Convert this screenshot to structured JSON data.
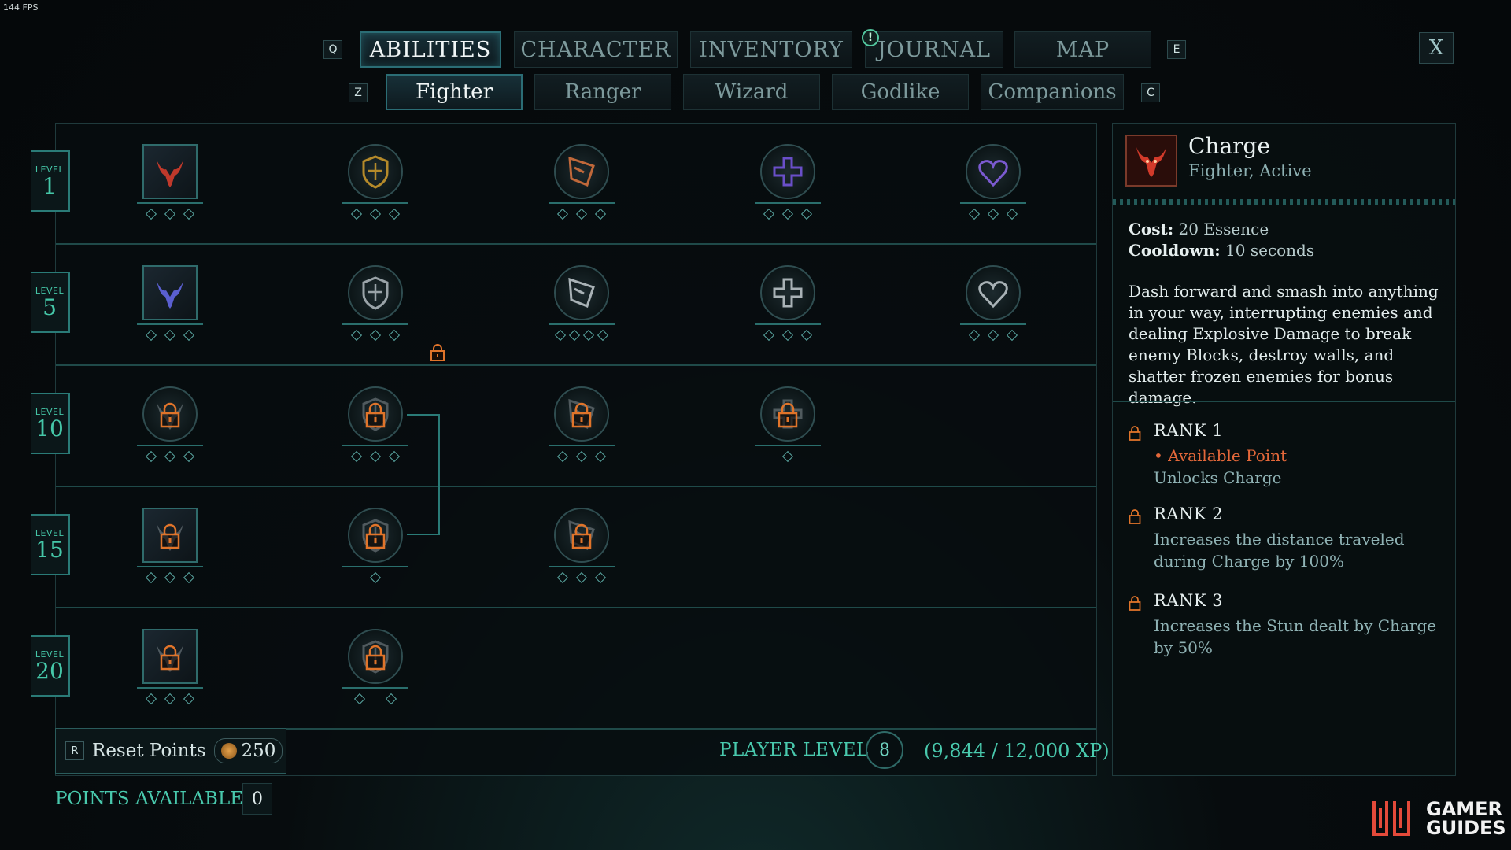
{
  "fps": "144 FPS",
  "nav": {
    "left_key": "Q",
    "right_key": "E",
    "tabs": [
      "ABILITIES",
      "CHARACTER",
      "INVENTORY",
      "JOURNAL",
      "MAP"
    ],
    "active_tab": "ABILITIES",
    "journal_alert": "!",
    "close": "X"
  },
  "subnav": {
    "left_key": "Z",
    "right_key": "C",
    "tabs": [
      "Fighter",
      "Ranger",
      "Wizard",
      "Godlike",
      "Companions"
    ],
    "active_tab": "Fighter"
  },
  "levels": [
    {
      "label": "LEVEL",
      "number": "1"
    },
    {
      "label": "LEVEL",
      "number": "5"
    },
    {
      "label": "LEVEL",
      "number": "10"
    },
    {
      "label": "LEVEL",
      "number": "15"
    },
    {
      "label": "LEVEL",
      "number": "20"
    }
  ],
  "abilities": [
    [
      {
        "icon": "bull-charge-icon",
        "shape": "square",
        "locked": false,
        "ranks": 3,
        "color": "#c0392b"
      },
      {
        "icon": "shield-burst-icon",
        "shape": "circle",
        "locked": false,
        "ranks": 3,
        "color": "#b58a2a"
      },
      {
        "icon": "shield-bash-icon",
        "shape": "circle",
        "locked": false,
        "ranks": 3,
        "color": "#c0683a"
      },
      {
        "icon": "holy-cross-icon",
        "shape": "circle",
        "locked": false,
        "ranks": 3,
        "color": "#6a4fc9"
      },
      {
        "icon": "heart-icon",
        "shape": "circle",
        "locked": false,
        "ranks": 3,
        "color": "#7b5ad0"
      }
    ],
    [
      {
        "icon": "dragon-claw-icon",
        "shape": "square",
        "locked": false,
        "ranks": 3,
        "color": "#5a5fd0"
      },
      {
        "icon": "axe-cleave-icon",
        "shape": "circle",
        "locked": false,
        "ranks": 3,
        "color": "#9aa3a8"
      },
      {
        "icon": "punch-icon",
        "shape": "circle",
        "locked": false,
        "ranks": 4,
        "color": "#a9b2b6"
      },
      {
        "icon": "skull-sword-icon",
        "shape": "circle",
        "locked": false,
        "ranks": 3,
        "color": "#a9b2b6"
      },
      {
        "icon": "battle-axe-icon",
        "shape": "circle",
        "locked": false,
        "ranks": 3,
        "color": "#a9b2b6"
      }
    ],
    [
      {
        "icon": "whirlwind-icon",
        "shape": "circle",
        "locked": true,
        "ranks": 3,
        "color": "#e0742a"
      },
      {
        "icon": "shield-guard-icon",
        "shape": "circle",
        "locked": true,
        "ranks": 3,
        "color": "#e0742a"
      },
      {
        "icon": "spin-slash-icon",
        "shape": "circle",
        "locked": true,
        "ranks": 3,
        "color": "#e0742a"
      },
      {
        "icon": "fortify-icon",
        "shape": "circle",
        "locked": true,
        "ranks": 1,
        "color": "#e0742a"
      }
    ],
    [
      {
        "icon": "leap-strike-icon",
        "shape": "square",
        "locked": true,
        "ranks": 3,
        "color": "#e0742a"
      },
      {
        "icon": "vortex-icon",
        "shape": "circle",
        "locked": true,
        "ranks": 1,
        "color": "#e0742a"
      },
      {
        "icon": "cyclone-icon",
        "shape": "circle",
        "locked": true,
        "ranks": 3,
        "color": "#e0742a"
      }
    ],
    [
      {
        "icon": "tornado-icon",
        "shape": "square",
        "locked": true,
        "ranks": 3,
        "color": "#e0742a"
      },
      {
        "icon": "warrior-icon",
        "shape": "circle",
        "locked": true,
        "ranks": 2,
        "color": "#e0742a"
      }
    ]
  ],
  "footer": {
    "reset_key": "R",
    "reset_label": "Reset Points",
    "reset_cost": "250",
    "player_level_label": "PLAYER LEVEL",
    "player_level": "8",
    "xp": "(9,844 / 12,000 XP)",
    "points_label": "POINTS AVAILABLE",
    "points": "0"
  },
  "detail": {
    "name": "Charge",
    "subtitle": "Fighter, Active",
    "cost_label": "Cost:",
    "cost": "20 Essence",
    "cooldown_label": "Cooldown:",
    "cooldown": "10 seconds",
    "description": "Dash forward and smash into anything in your way, interrupting enemies and dealing Explosive Damage to break enemy Blocks, destroy walls, and shatter frozen enemies for bonus damage.",
    "ranks": [
      {
        "title": "RANK 1",
        "note": "• Available Point",
        "text": "Unlocks Charge"
      },
      {
        "title": "RANK 2",
        "note": "",
        "text": "Increases the distance traveled during Charge by 100%"
      },
      {
        "title": "RANK 3",
        "note": "",
        "text": "Increases the Stun dealt by Charge by 50%"
      }
    ]
  },
  "brand": {
    "line1": "GAMER",
    "line2": "GUIDES"
  }
}
